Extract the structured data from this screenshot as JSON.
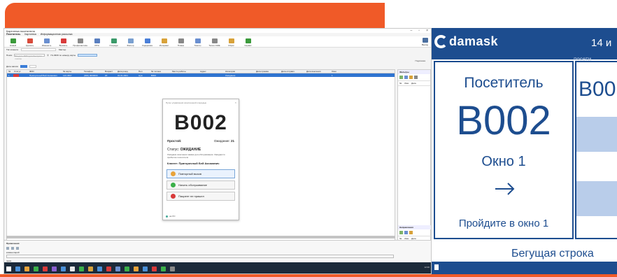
{
  "app": {
    "title": "Картотека посетителя",
    "tabs": [
      "Посетитель",
      "Картотека",
      "Информационная рассылка"
    ],
    "ribbon": [
      {
        "label": "Новый",
        "color": "#3b9a3b"
      },
      {
        "label": "Удалить",
        "color": "#d84a3a"
      },
      {
        "label": "Изменить",
        "color": "#6a8fd0"
      },
      {
        "label": "Вызвать",
        "color": "#d83a3a"
      },
      {
        "label": "Профилактика",
        "color": "#8a8a8a"
      },
      {
        "label": "РРЭ",
        "color": "#5a7fc0"
      },
      {
        "label": "Очереди",
        "color": "#3b9a6a"
      },
      {
        "label": "Фильтр",
        "color": "#7aa0d0"
      },
      {
        "label": "Кодировка",
        "color": "#4a7fd8"
      },
      {
        "label": "Интервал",
        "color": "#d8a23a"
      },
      {
        "label": "Планы",
        "color": "#888888"
      },
      {
        "label": "Тикеты",
        "color": "#6a8fd0"
      },
      {
        "label": "Талон ОЖЕ",
        "color": "#888888"
      },
      {
        "label": "Сброс",
        "color": "#d8a23a"
      },
      {
        "label": "Сервис",
        "color": "#3b9a3b"
      }
    ],
    "exit_label": "Выход",
    "filter_label": "Тип клиента",
    "filter_value": "Мастер",
    "search_label": "Поиск",
    "search_placeholder": "Введите ФИО для быстрого поиска",
    "search_hint": "По ФИО по номеру карты",
    "help_label": "Подсказка",
    "period_label": "Дата записи",
    "grid_headers": [
      "№",
      "Статус",
      "ФИО",
      "№ карты",
      "Телефон",
      "Возраст",
      "Дата рожд.",
      "Пол",
      "№ талона",
      "Место работы",
      "Адрес",
      "Категория",
      "Дата приема",
      "Дата отправл.",
      "Дата внесения",
      "Окно"
    ],
    "grid_row": [
      "1",
      "",
      "Пригорочный Бей Аксакович",
      "123 4567",
      "(000) 0000000",
      "20",
      "01.01.2001",
      "муж",
      "B002",
      "",
      "",
      "Ожидание",
      "",
      "",
      "",
      "1"
    ],
    "info_label": "Примечания",
    "info_field_label": "комментарий",
    "info_label2": "прим.",
    "clock": "12:00"
  },
  "right_panel": {
    "title": "Фильтры",
    "cols": [
      "№",
      "Имя",
      "Дата"
    ],
    "title2": "Направления",
    "cols2": [
      "№",
      "Имя",
      "Дата"
    ],
    "bottom": "Направления на"
  },
  "dialog": {
    "title": "Пульт управления электронной очередью",
    "ticket": "B002",
    "idle_label": "Простой:",
    "wait_label": "Ожидание:",
    "wait_value": "21",
    "status_label": "Статус:",
    "status_value": "ОЖИДАНИЕ",
    "note": "Ожидаем окончания заявки для обслуживания. Ожидается прибытие посетителя",
    "client_label": "Клиент:",
    "client_value": "Пригорочный Бей Аксакович",
    "buttons": [
      {
        "label": "Повторный вызов",
        "color": "#e8a33a"
      },
      {
        "label": "Начать обслуживание",
        "color": "#3bb04a"
      },
      {
        "label": "Пациент не пришел",
        "color": "#d83a3a"
      }
    ],
    "footer": "на ЛО"
  },
  "board": {
    "logo_text": "damask",
    "date": "14 и",
    "visitor_col_label": "посети",
    "card_title": "Посетитель",
    "ticket": "B002",
    "window": "Окно 1",
    "hint": "Пройдите в окно 1",
    "queue_ticket": "B00",
    "ticker": "Бегущая строка",
    "colors": {
      "brand": "#1d4d8f",
      "band": "#b9cdea",
      "accent": "#f05a28"
    }
  }
}
